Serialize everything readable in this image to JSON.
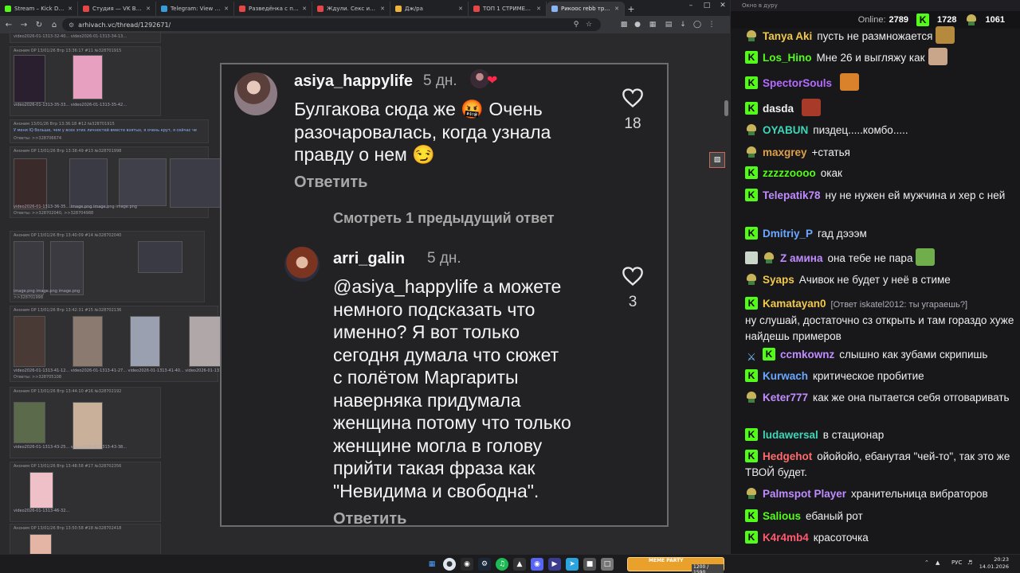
{
  "browser": {
    "tabs": [
      {
        "label": "Stream – Kick Dashboard",
        "color": "#53fc18"
      },
      {
        "label": "Студия — VK Видео Live",
        "color": "#e64646"
      },
      {
        "label": "Telegram: View @Petyun",
        "color": "#3a9bd9"
      },
      {
        "label": "Разведёнка с прицепом",
        "color": "#e64646"
      },
      {
        "label": "Ждули. Секс и отношения",
        "color": "#e64646"
      },
      {
        "label": "Дж/ра",
        "color": "#f0b43c"
      },
      {
        "label": "ТОП 1 СТРИМЕР В МИРЕ",
        "color": "#e64646"
      },
      {
        "label": "Рикоос rebb тред. Бул",
        "color": "#8ab4f8"
      }
    ],
    "url": "arhivach.vc/thread/1292671/"
  },
  "thread": {
    "posts": [
      {
        "header": "video2026-01-1313-32-40...  video2026-01-1313-34-13..."
      },
      {
        "header": "Аноним OP 13/01/26 Втр 13:36:17 #11 №328701915",
        "caption": "video2026-01-1313-35-33...  video2026-01-1313-35-42..."
      },
      {
        "header": "Аноним 13/01/26 Втр 13:36:18 #12 №328701915",
        "text": "У меня IQ больше, чем у всех этих личностей вместе взятых, я очень крут, я сейчас че",
        "replies": "Ответы: >>328706674"
      },
      {
        "header": "Аноним OP 13/01/26 Втр 13:38:49 #13 №328701998",
        "caption": "video2026-01-1313-36-35...  image.png  image.png  image.png",
        "replies": "Ответы: >>328702040, >>328704988"
      },
      {
        "header": "Аноним OP 13/01/26 Втр 13:40:09 #14 №328702040",
        "caption": "image.png  image.png  image.png",
        "replies": ">>328701998"
      },
      {
        "header": "Аноним OP 13/01/26 Втр 13:42:31 #15 №328702136",
        "caption": "video2026-01-1313-41-12...  video2026-01-1313-41-27...  video2026-01-1313-41-40...  video2026-01-1313-41-45...",
        "replies": "Ответы: >>328705108"
      },
      {
        "header": "Аноним OP 13/01/26 Втр 13:44:10 #16 №328702192",
        "caption": "video2026-01-1313-43-25...  video2026-01-1313-43-38..."
      },
      {
        "header": "Аноним OP 13/01/26 Втр 13:48:58 #17 №328702356",
        "caption": "video2026-01-1313-46-32..."
      },
      {
        "header": "Аноним OP 13/01/26 Втр 13:50:58 #18 №328702418"
      }
    ]
  },
  "comments": [
    {
      "user": "asiya_happylife",
      "time": "5 дн.",
      "text": [
        "Булгакова сюда же 🤬 Очень",
        "разочаровалась, когда узнала",
        "правду о нем 😏"
      ],
      "likes": "18",
      "reply_label": "Ответить"
    },
    {
      "user": "arri_galin",
      "time": "5 дн.",
      "text": [
        "@asiya_happylife а можете",
        "немного подсказать что",
        "именно? Я вот только",
        "сегодня думала что сюжет",
        "с полётом Маргариты",
        "наверняка придумала",
        "женщина потому что только",
        "женщине могла в голову",
        "прийти такая фраза как",
        "\"Невидима и свободна\"."
      ],
      "likes": "3",
      "reply_label": "Ответить"
    }
  ],
  "more_replies": "Смотреть 1 предыдущий ответ",
  "chat": {
    "window_title": "Окно в дуру",
    "online_label": "Online:",
    "online": "2789",
    "kick_count": "1728",
    "sub_count": "1061",
    "messages": [
      {
        "badges": [
          "sub"
        ],
        "user": "Tanya Aki",
        "color": "#f2c94c",
        "text": "пусть не размножается",
        "emote": "#b58a3c"
      },
      {
        "badges": [
          "k"
        ],
        "user": "Los_Hino",
        "color": "#53fc18",
        "text": "Мне 26 и выгляжу как",
        "emote": "#c9a58a"
      },
      {
        "badges": [
          "k"
        ],
        "user": "SpectorSouls",
        "color": "#b46cff",
        "text": "",
        "emote": "#d9822b"
      },
      {
        "badges": [
          "k"
        ],
        "user": "dasda",
        "color": "#f0f0f0",
        "text": "",
        "emote": "#a83a2a"
      },
      {
        "badges": [
          "sub"
        ],
        "user": "OYABUN",
        "color": "#3fd6b8",
        "text": "пиздец.....комбо....."
      },
      {
        "badges": [
          "sub"
        ],
        "user": "maxgrey",
        "color": "#e0a04a",
        "text": "+статья"
      },
      {
        "badges": [
          "k"
        ],
        "user": "zzzzzoooo",
        "color": "#53fc18",
        "text": "окак"
      },
      {
        "badges": [
          "k"
        ],
        "user": "Telepatik78",
        "color": "#c08cff",
        "text": "ну не нужен ей мужчина и хер с ней"
      },
      {
        "badges": [
          "k"
        ],
        "user": "Dmitriy_P",
        "color": "#6aa8ff",
        "text": "гад дэээм"
      },
      {
        "badges": [
          "ticket",
          "sub"
        ],
        "user": "Z амина",
        "color": "#c08cff",
        "text": "она тебе не пара",
        "emote": "#6fae4a"
      },
      {
        "badges": [
          "sub"
        ],
        "user": "Syaps",
        "color": "#f2c94c",
        "text": "Ачивок не будет у неё в стиме"
      },
      {
        "badges": [
          "k"
        ],
        "user": "Kamatayan0",
        "color": "#f2c94c",
        "reply": "[Ответ iskatel2012: ты угараешь?]",
        "text": "ну слушай, достаточно сз открыть и там гораздо хуже найдешь примеров"
      },
      {
        "badges": [
          "sword",
          "k"
        ],
        "user": "ccmkownz",
        "color": "#c08cff",
        "text": "слышно как зубами скрипишь"
      },
      {
        "badges": [
          "k"
        ],
        "user": "Kurwach",
        "color": "#6aa8ff",
        "text": "критическое пробитие"
      },
      {
        "badges": [
          "sub"
        ],
        "user": "Keter777",
        "color": "#c08cff",
        "text": "как же она пытается себя отговаривать"
      },
      {
        "badges": [
          "k"
        ],
        "user": "ludawersal",
        "color": "#3fd6b8",
        "text": "в стационар"
      },
      {
        "badges": [
          "k"
        ],
        "user": "Hedgehot",
        "color": "#ff6b6b",
        "text": "ойойойо, ебанутая \"чей-то\", так это же ТВОЙ будет."
      },
      {
        "badges": [
          "sub"
        ],
        "user": "Palmspot Player",
        "color": "#c08cff",
        "text": "хранительница вибраторов"
      },
      {
        "badges": [
          "k"
        ],
        "user": "Salious",
        "color": "#53fc18",
        "text": "ебаный рот"
      },
      {
        "badges": [
          "k"
        ],
        "user": "K4r4mb4",
        "color": "#ff5a6e",
        "text": "красоточка"
      }
    ]
  },
  "taskbar": {
    "meme_title": "MEME PARTY",
    "meme_count": "1200 / 1590",
    "lang": "РУС",
    "time": "20:23",
    "date": "14.01.2026"
  }
}
